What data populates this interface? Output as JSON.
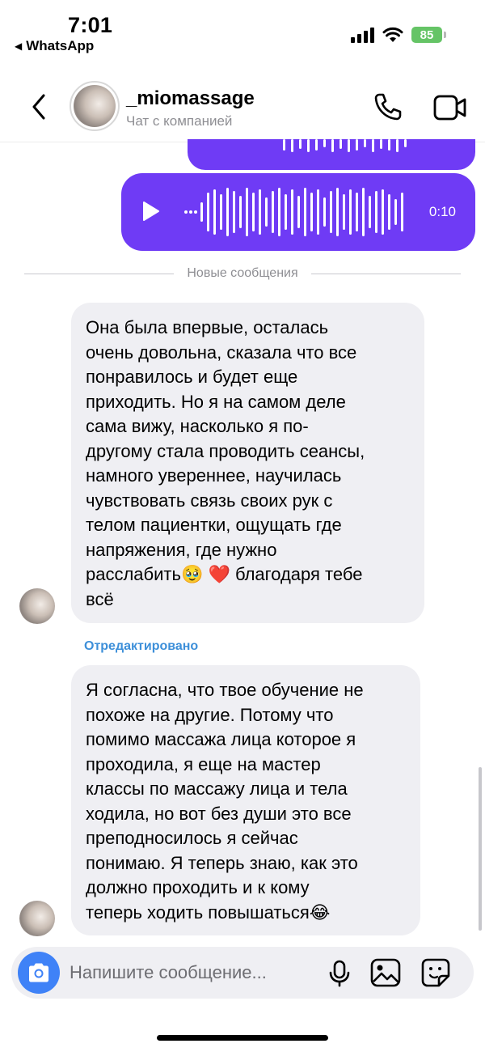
{
  "status_bar": {
    "time": "7:01",
    "back_app": "WhatsApp",
    "battery": "85"
  },
  "header": {
    "contact_name": "_miomassage",
    "contact_subtitle": "Чат с компанией"
  },
  "voice_message": {
    "duration": "0:10"
  },
  "divider": {
    "label": "Новые сообщения"
  },
  "messages": [
    {
      "text": "Она была впервые, осталась\nочень довольна, сказала что все\nпонравилось и будет еще\nприходить. Но я на самом деле\nсама вижу, насколько я по-\nдругому стала проводить сеансы,\nнамного увереннее, научилась\nчувствовать связь своих рук с\nтелом пациентки, ощущать где\nнапряжения, где нужно\nрасслабить🥹 ❤️  благодаря тебе\nвсё"
    },
    {
      "edited_label": "Отредактировано",
      "text": "Я согласна, что твое обучение не\nпохоже на другие. Потому что\nпомимо массажа лица которое я\nпроходила, я еще на мастер\nклассы по массажу лица и тела\nходила, но вот без души это все\nпреподносилось я сейчас\nпонимаю. Я теперь знаю, как это\nдолжно проходить и к кому\nтеперь ходить повышаться😂"
    }
  ],
  "composer": {
    "placeholder": "Напишите сообщение..."
  },
  "colors": {
    "outgoing_bubble": "#6f3bf5",
    "incoming_bubble": "#efeff3",
    "camera_button": "#3f82f7",
    "battery_green": "#65c466",
    "edited_label": "#3d8fd9"
  },
  "icons": [
    "chevron-left-icon",
    "phone-icon",
    "video-camera-icon",
    "play-icon",
    "camera-icon",
    "microphone-icon",
    "gallery-icon",
    "sticker-icon",
    "signal-icon",
    "wifi-icon",
    "battery-icon"
  ]
}
